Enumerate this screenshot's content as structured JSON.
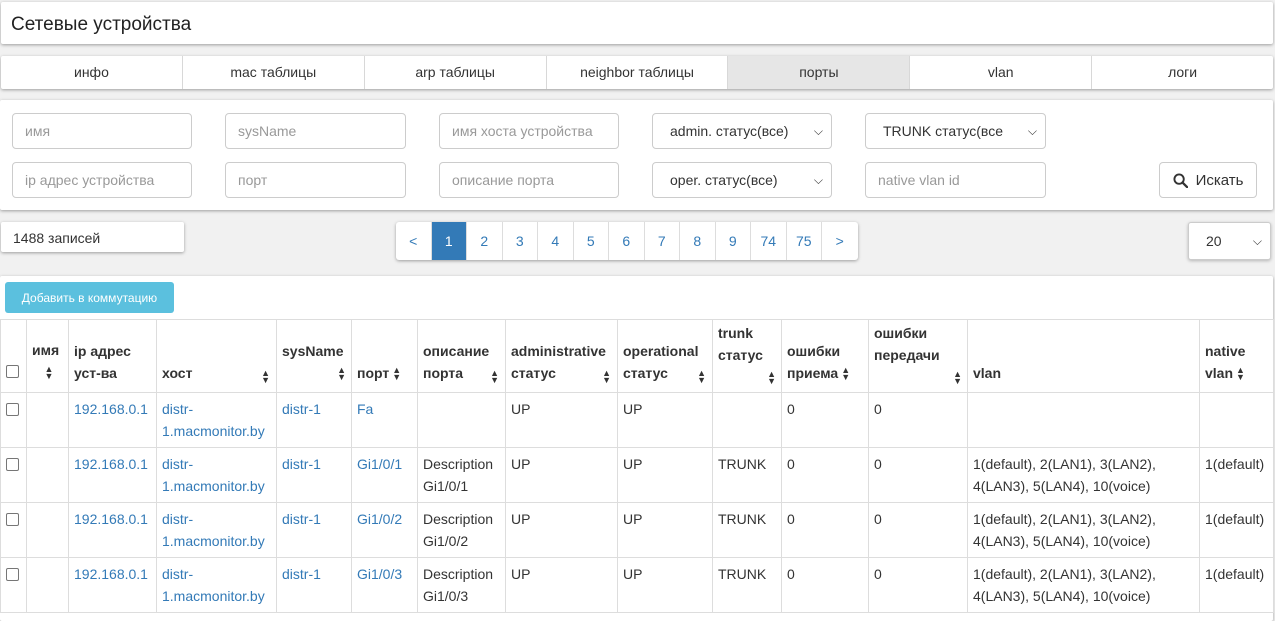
{
  "page": {
    "title": "Сетевые устройства"
  },
  "tabs": [
    {
      "label": "инфо"
    },
    {
      "label": "mac таблицы"
    },
    {
      "label": "arp таблицы"
    },
    {
      "label": "neighbor таблицы"
    },
    {
      "label": "порты",
      "active": true
    },
    {
      "label": "vlan"
    },
    {
      "label": "логи"
    }
  ],
  "filters": {
    "name_placeholder": "имя",
    "sysname_placeholder": "sysName",
    "hostname_placeholder": "имя хоста устройства",
    "admin_status": "admin. статус(все)",
    "trunk_status": "TRUNK статус(все",
    "ip_placeholder": "ip адрес устройства",
    "port_placeholder": "порт",
    "port_desc_placeholder": "описание порта",
    "oper_status": "oper. статус(все)",
    "native_vlan_placeholder": "native vlan id",
    "search_label": "Искать"
  },
  "records": {
    "count_text": "1488 записей"
  },
  "pagination": {
    "prev": "<",
    "next": ">",
    "pages": [
      "1",
      "2",
      "3",
      "4",
      "5",
      "6",
      "7",
      "8",
      "9",
      "74",
      "75"
    ],
    "current": "1",
    "page_size": "20"
  },
  "actions": {
    "add_label": "Добавить в коммутацию"
  },
  "table": {
    "headers": {
      "name": "имя",
      "ip": [
        "ip адрес",
        "уст-ва"
      ],
      "host": "хост",
      "sysname": "sysName",
      "port": "порт",
      "desc": [
        "описание",
        "порта"
      ],
      "admin": [
        "administrative",
        "статус"
      ],
      "oper": [
        "operational",
        "статус"
      ],
      "trunk": [
        "trunk",
        "статус"
      ],
      "rxerr": [
        "ошибки",
        "приема"
      ],
      "txerr": [
        "ошибки",
        "передачи"
      ],
      "vlan": "vlan",
      "native": [
        "native",
        "vlan"
      ]
    },
    "rows": [
      {
        "name": "",
        "ip": "192.168.0.1",
        "host": [
          "distr-",
          "1.macmonitor.by"
        ],
        "sysname": "distr-1",
        "port": "Fa",
        "desc": [
          "",
          ""
        ],
        "admin": "UP",
        "oper": "UP",
        "trunk": "",
        "rxerr": "0",
        "txerr": "0",
        "vlan": [
          "",
          ""
        ],
        "native": ""
      },
      {
        "name": "",
        "ip": "192.168.0.1",
        "host": [
          "distr-",
          "1.macmonitor.by"
        ],
        "sysname": "distr-1",
        "port": "Gi1/0/1",
        "desc": [
          "Description",
          "Gi1/0/1"
        ],
        "admin": "UP",
        "oper": "UP",
        "trunk": "TRUNK",
        "rxerr": "0",
        "txerr": "0",
        "vlan": [
          "1(default), 2(LAN1), 3(LAN2),",
          "4(LAN3), 5(LAN4), 10(voice)"
        ],
        "native": "1(default)"
      },
      {
        "name": "",
        "ip": "192.168.0.1",
        "host": [
          "distr-",
          "1.macmonitor.by"
        ],
        "sysname": "distr-1",
        "port": "Gi1/0/2",
        "desc": [
          "Description",
          "Gi1/0/2"
        ],
        "admin": "UP",
        "oper": "UP",
        "trunk": "TRUNK",
        "rxerr": "0",
        "txerr": "0",
        "vlan": [
          "1(default), 2(LAN1), 3(LAN2),",
          "4(LAN3), 5(LAN4), 10(voice)"
        ],
        "native": "1(default)"
      },
      {
        "name": "",
        "ip": "192.168.0.1",
        "host": [
          "distr-",
          "1.macmonitor.by"
        ],
        "sysname": "distr-1",
        "port": "Gi1/0/3",
        "desc": [
          "Description",
          "Gi1/0/3"
        ],
        "admin": "UP",
        "oper": "UP",
        "trunk": "TRUNK",
        "rxerr": "0",
        "txerr": "0",
        "vlan": [
          "1(default), 2(LAN1), 3(LAN2),",
          "4(LAN3), 5(LAN4), 10(voice)"
        ],
        "native": "1(default)"
      }
    ]
  },
  "colors": {
    "link": "#337ab7",
    "active_page": "#337ab7",
    "add_button": "#5bc0de",
    "active_tab": "#e6e6e6"
  },
  "icons": {
    "search": "search-icon",
    "sort": "sort-icon",
    "dropdown": "chevron-down-icon"
  }
}
